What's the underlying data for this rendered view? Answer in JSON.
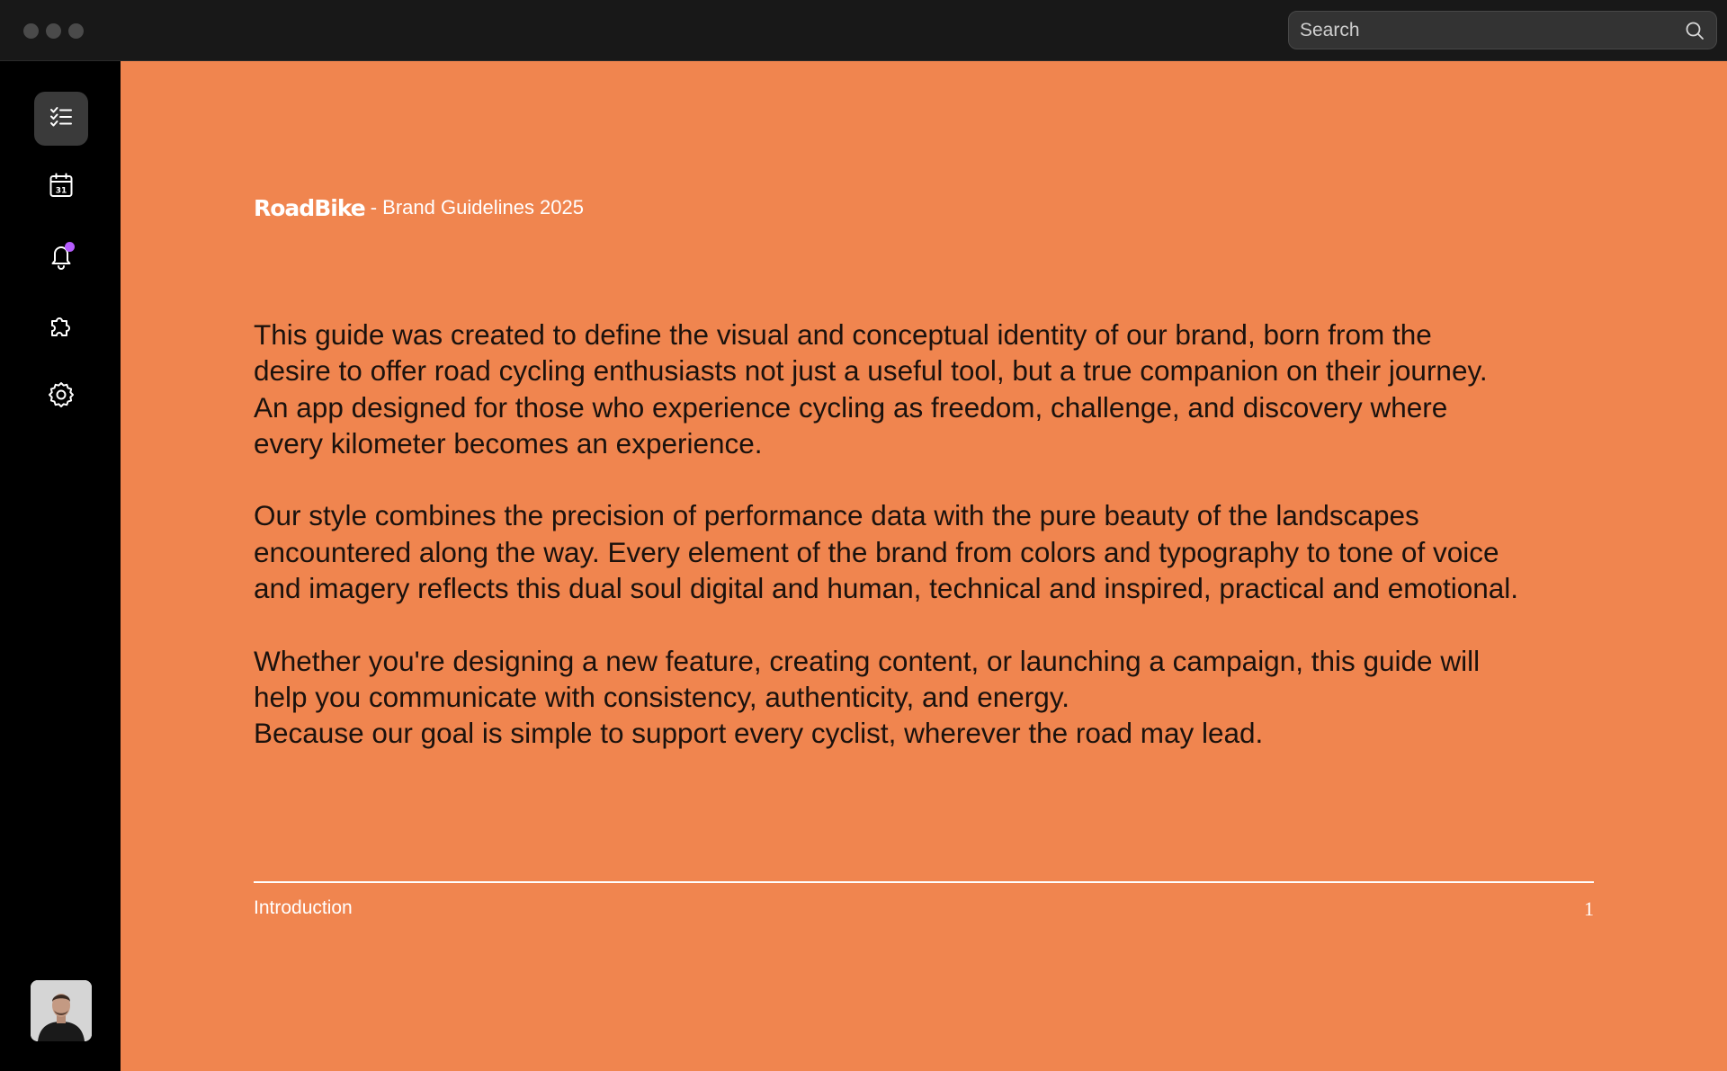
{
  "window": {
    "controls": [
      "close",
      "minimize",
      "zoom"
    ]
  },
  "search": {
    "placeholder": "Search",
    "icon": "search-icon"
  },
  "sidebar": {
    "items": [
      {
        "name": "checklist",
        "icon": "checklist-icon",
        "active": true
      },
      {
        "name": "calendar",
        "icon": "calendar-icon",
        "calendar_day": "31",
        "active": false
      },
      {
        "name": "notifications",
        "icon": "bell-icon",
        "has_badge": true,
        "active": false
      },
      {
        "name": "extensions",
        "icon": "puzzle-icon",
        "active": false
      },
      {
        "name": "settings",
        "icon": "gear-icon",
        "active": false
      }
    ],
    "user": {
      "icon": "avatar"
    }
  },
  "document": {
    "brand": "RoadBike",
    "subtitle": "- Brand Guidelines 2025",
    "paragraphs": [
      "This guide was created to define the visual and conceptual identity of our brand, born from the\ndesire to offer road cycling enthusiasts not just a useful tool, but a true companion on their journey.\nAn app designed for those who experience cycling as freedom, challenge, and discovery where\nevery kilometer becomes an experience.",
      "Our style combines the precision of performance data with the pure beauty of the landscapes\nencountered along the way. Every element of the brand from colors and typography to tone of voice\nand imagery reflects this dual soul digital and human, technical and inspired, practical and emotional.",
      "Whether you're designing a new feature, creating content, or launching a campaign, this guide will\nhelp you communicate with consistency, authenticity, and energy.\nBecause our goal is simple to support every cyclist, wherever the road may lead."
    ],
    "footer": {
      "section": "Introduction",
      "page": "1"
    }
  },
  "colors": {
    "page_background": "#f0854f",
    "sidebar_background": "#000000",
    "titlebar_background": "#181818",
    "notification_badge": "#b65cff",
    "text": "#1b120d"
  }
}
